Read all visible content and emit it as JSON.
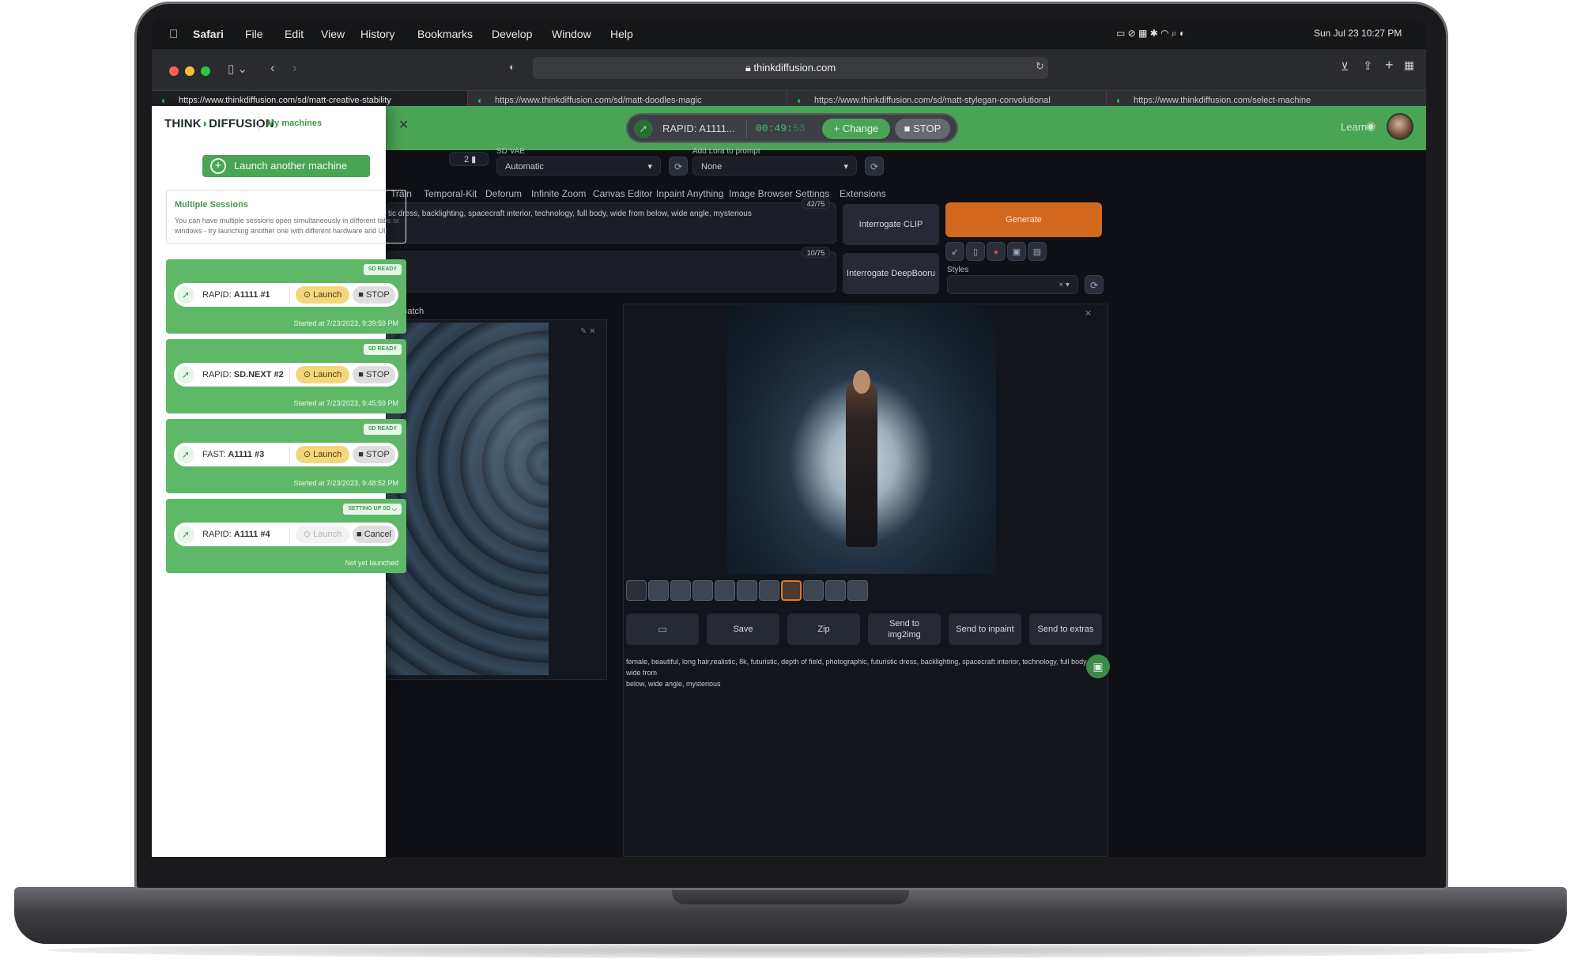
{
  "menubar": {
    "apple": "",
    "app": "Safari",
    "items": [
      "File",
      "Edit",
      "View",
      "History",
      "Bookmarks",
      "Develop",
      "Window",
      "Help"
    ],
    "clock": "Sun Jul 23  10:27 PM"
  },
  "browser": {
    "url": "thinkdiffusion.com",
    "tabs": [
      "https://www.thinkdiffusion.com/sd/matt-creative-stability",
      "https://www.thinkdiffusion.com/sd/matt-doodles-magic",
      "https://www.thinkdiffusion.com/sd/matt-stylegan-convolutional",
      "https://www.thinkdiffusion.com/select-machine"
    ]
  },
  "topbar": {
    "machine": "RAPID: A1111...",
    "timer_main": "00:49:",
    "timer_dim": "53",
    "change": "Change",
    "stop": "STOP",
    "learn": "Learn"
  },
  "webui": {
    "batch_count": "2",
    "sd_vae_label": "SD VAE",
    "sd_vae_value": "Automatic",
    "lora_label": "Add Lora to prompt",
    "lora_value": "None",
    "tabs": [
      "Train",
      "Temporal-Kit",
      "Deforum",
      "Infinite Zoom",
      "Canvas Editor",
      "Inpaint Anything",
      "Image Browser",
      "Settings",
      "Extensions"
    ],
    "prompt": "tic dress, backlighting, spacecraft interior, technology, full body, wide from below, wide angle, mysterious",
    "prompt_count": "42/75",
    "neg_count": "10/75",
    "interrogate_clip": "Interrogate CLIP",
    "interrogate_deepbooru": "Interrogate DeepBooru",
    "generate": "Generate",
    "styles_label": "Styles",
    "batch_label": "Batch",
    "actions": [
      "Save",
      "Zip",
      "Send to img2img",
      "Send to inpaint",
      "Send to extras"
    ],
    "caption_line1": "female, beautiful, long hair,realistic, 8k, futuristic, depth of field, photographic, futuristic dress, backlighting, spacecraft interior, technology, full body, wide from",
    "caption_line2": "below, wide angle, mysterious"
  },
  "sidebar": {
    "logo_a": "THINK",
    "logo_b": "DIFFUSION",
    "my_machines": "My machines",
    "launch_another": "Launch another machine",
    "info_title": "Multiple Sessions",
    "info_body": "You can have multiple sessions open simultaneously in different tabs or windows - try launching another one with different hardware and UI!",
    "cards": [
      {
        "badge": "SD READY",
        "type": "RAPID:",
        "name": "A1111 #1",
        "launch": "Launch",
        "stop": "STOP",
        "status": "Started at 7/23/2023, 9:39:59 PM"
      },
      {
        "badge": "SD READY",
        "type": "RAPID:",
        "name": "SD.NEXT #2",
        "launch": "Launch",
        "stop": "STOP",
        "status": "Started at 7/23/2023, 9:45:59 PM"
      },
      {
        "badge": "SD READY",
        "type": "FAST:",
        "name": "A1111 #3",
        "launch": "Launch",
        "stop": "STOP",
        "status": "Started at 7/23/2023, 9:48:52 PM"
      },
      {
        "badge": "SETTING UP SD",
        "type": "RAPID:",
        "name": "A1111 #4",
        "launch": "Launch",
        "stop": "Cancel",
        "status": "Not yet launched"
      }
    ]
  },
  "colors": {
    "brand_green": "#4aa455",
    "generate_orange": "#d2691e"
  }
}
